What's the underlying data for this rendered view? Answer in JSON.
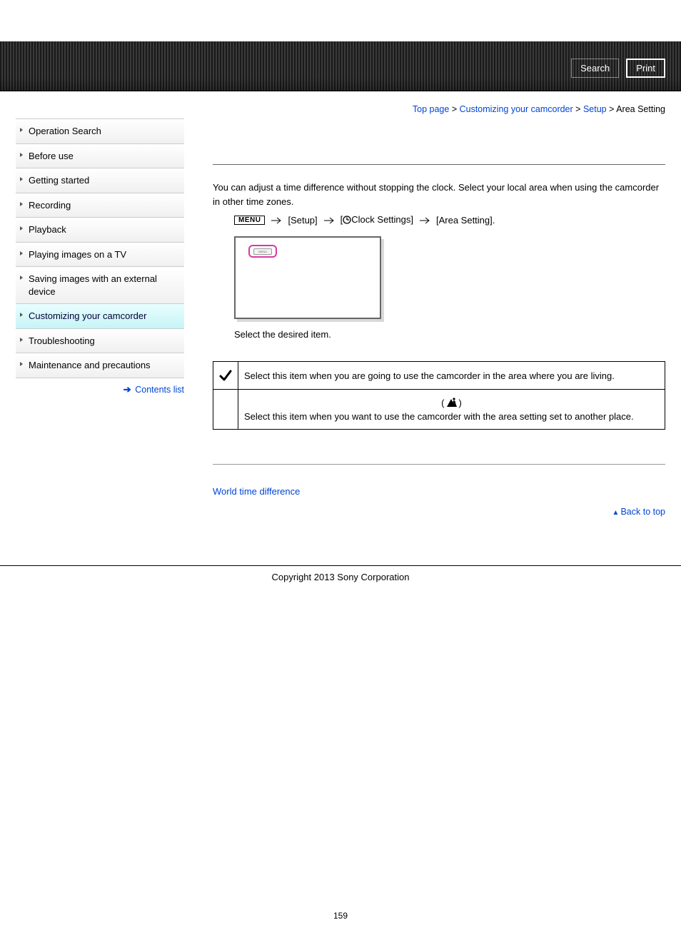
{
  "header": {
    "search_label": "Search",
    "print_label": "Print"
  },
  "sidebar": {
    "items": [
      {
        "label": "Operation Search"
      },
      {
        "label": "Before use"
      },
      {
        "label": "Getting started"
      },
      {
        "label": "Recording"
      },
      {
        "label": "Playback"
      },
      {
        "label": "Playing images on a TV"
      },
      {
        "label": "Saving images with an external device"
      },
      {
        "label": "Customizing your camcorder"
      },
      {
        "label": "Troubleshooting"
      },
      {
        "label": "Maintenance and precautions"
      }
    ],
    "contents_link": "Contents list"
  },
  "breadcrumb": {
    "top": "Top page",
    "customizing": "Customizing your camcorder",
    "setup": "Setup",
    "current": "Area Setting"
  },
  "main": {
    "intro": "You can adjust a time difference without stopping the clock. Select your local area when using the camcorder in other time zones.",
    "nav": {
      "menu": "MENU",
      "setup": "[Setup]",
      "clock_prefix": "[",
      "clock_label": "Clock Settings]",
      "area": "[Area Setting]."
    },
    "illus_chip": "MENU",
    "step2": "Select the desired item.",
    "options": {
      "home": "Select this item when you are going to use the camcorder in the area where you are living.",
      "dest_icon_wrap_open": "(",
      "dest_icon_wrap_close": ")",
      "dest": "Select this item when you want to use the camcorder with the area setting set to another place."
    },
    "related": "World time difference",
    "back_to_top": "Back to top"
  },
  "footer": {
    "copyright": "Copyright 2013 Sony Corporation",
    "page_number": "159"
  }
}
